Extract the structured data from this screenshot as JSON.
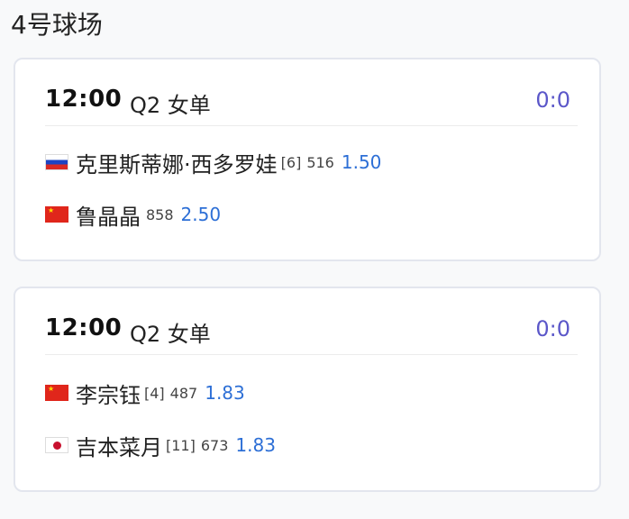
{
  "court": {
    "title": "4号球场"
  },
  "matches": [
    {
      "time": "12:00",
      "round": "Q2 女单",
      "score": "0:0",
      "players": [
        {
          "flag": "russia-flag",
          "name": "克里斯蒂娜·西多罗娃",
          "seed": "[6]",
          "rank": "516",
          "odds": "1.50"
        },
        {
          "flag": "china-flag",
          "name": "鲁晶晶",
          "seed": "",
          "rank": "858",
          "odds": "2.50"
        }
      ]
    },
    {
      "time": "12:00",
      "round": "Q2 女单",
      "score": "0:0",
      "players": [
        {
          "flag": "china-flag",
          "name": "李宗钰",
          "seed": "[4]",
          "rank": "487",
          "odds": "1.83"
        },
        {
          "flag": "japan-flag",
          "name": "吉本菜月",
          "seed": "[11]",
          "rank": "673",
          "odds": "1.83"
        }
      ]
    }
  ],
  "colors": {
    "score": "#5b57c9",
    "odds": "#2d6fd6"
  }
}
